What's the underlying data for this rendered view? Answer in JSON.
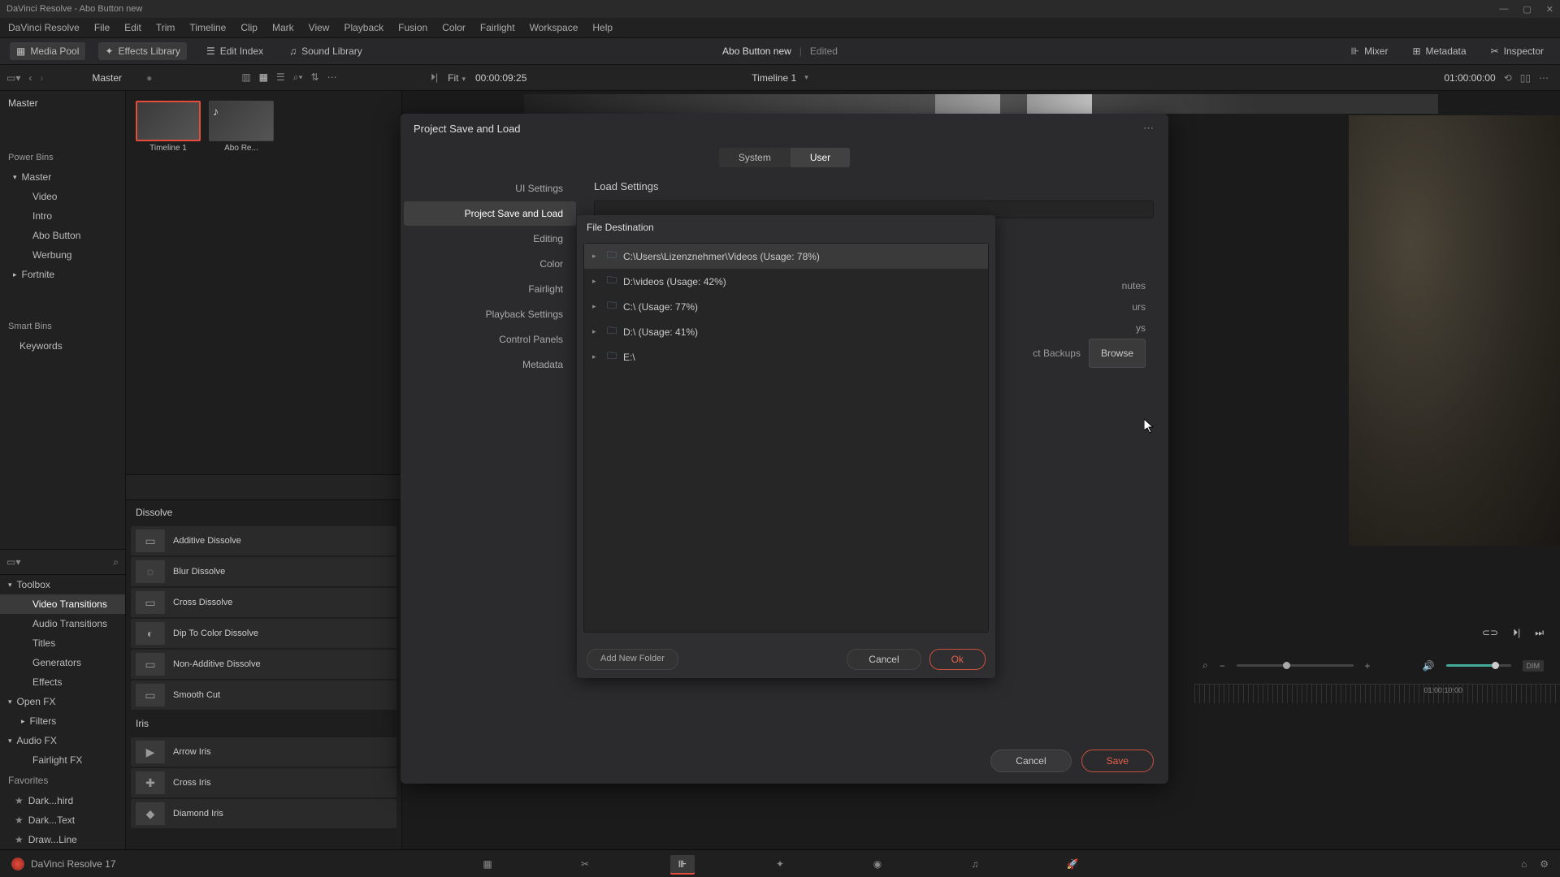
{
  "title_bar": "DaVinci Resolve - Abo Button new",
  "menu": [
    "DaVinci Resolve",
    "File",
    "Edit",
    "Trim",
    "Timeline",
    "Clip",
    "Mark",
    "View",
    "Playback",
    "Fusion",
    "Color",
    "Fairlight",
    "Workspace",
    "Help"
  ],
  "workspace": {
    "media_pool": "Media Pool",
    "effects": "Effects Library",
    "edit_index": "Edit Index",
    "sound": "Sound Library",
    "project": "Abo Button new",
    "edited": "Edited",
    "mixer": "Mixer",
    "metadata": "Metadata",
    "inspector": "Inspector"
  },
  "sub": {
    "master": "Master",
    "fit": "Fit",
    "tc_left": "00:00:09:25",
    "timeline": "Timeline 1",
    "tc_right": "01:00:00:00"
  },
  "pool": {
    "master": "Master",
    "power": "Power Bins",
    "power_root": "Master",
    "power_items": [
      "Video",
      "Intro",
      "Abo Button",
      "Werbung",
      "Fortnite"
    ],
    "smart": "Smart Bins",
    "smart_items": [
      "Keywords"
    ]
  },
  "thumbs": [
    {
      "label": "Timeline 1",
      "selected": true,
      "audio": false
    },
    {
      "label": "Abo Re...",
      "selected": false,
      "audio": true
    }
  ],
  "fx": {
    "toolbox": "Toolbox",
    "tree": [
      "Video Transitions",
      "Audio Transitions",
      "Titles",
      "Generators",
      "Effects"
    ],
    "openfx": "Open FX",
    "openfx_items": [
      "Filters"
    ],
    "audiofx": "Audio FX",
    "audiofx_items": [
      "Fairlight FX"
    ],
    "favorites": "Favorites",
    "fav_items": [
      "Dark...hird",
      "Dark...Text",
      "Draw...Line"
    ],
    "cat1": "Dissolve",
    "cat1_items": [
      "Additive Dissolve",
      "Blur Dissolve",
      "Cross Dissolve",
      "Dip To Color Dissolve",
      "Non-Additive Dissolve",
      "Smooth Cut"
    ],
    "cat2": "Iris",
    "cat2_items": [
      "Arrow Iris",
      "Cross Iris",
      "Diamond Iris"
    ]
  },
  "dlg": {
    "title": "Project Save and Load",
    "tab_system": "System",
    "tab_user": "User",
    "side": [
      "UI Settings",
      "Project Save and Load",
      "Editing",
      "Color",
      "Fairlight",
      "Playback Settings",
      "Control Panels",
      "Metadata"
    ],
    "side_sel": 1,
    "sec": "Load Settings",
    "peek_lines": [
      "nutes",
      "urs",
      "ys",
      "ct Backups"
    ],
    "browse": "Browse",
    "cancel": "Cancel",
    "save": "Save"
  },
  "popup": {
    "title": "File Destination",
    "items": [
      {
        "label": "C:\\Users\\Lizenznehmer\\Videos (Usage: 78%)",
        "sel": true
      },
      {
        "label": "D:\\videos (Usage: 42%)",
        "sel": false
      },
      {
        "label": "C:\\ (Usage: 77%)",
        "sel": false
      },
      {
        "label": "D:\\ (Usage: 41%)",
        "sel": false
      },
      {
        "label": "E:\\",
        "sel": false
      }
    ],
    "add": "Add New Folder",
    "cancel": "Cancel",
    "ok": "Ok"
  },
  "ruler_tc": "01:00:10:00",
  "dim": "DIM",
  "page_left": "DaVinci Resolve 17"
}
